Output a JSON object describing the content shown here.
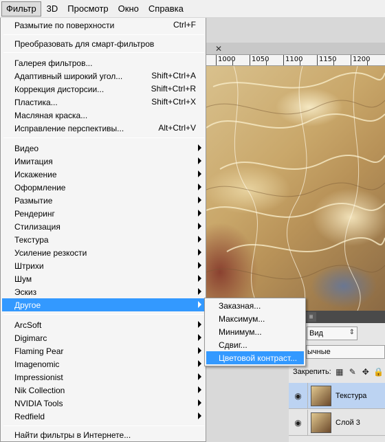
{
  "menubar": {
    "items": [
      "Фильтр",
      "3D",
      "Просмотр",
      "Окно",
      "Справка"
    ]
  },
  "ruler": {
    "labels": [
      "1000",
      "1050",
      "1100",
      "1150",
      "1200"
    ]
  },
  "filter_menu": {
    "group1": [
      {
        "label": "Размытие по поверхности",
        "shortcut": "Ctrl+F"
      }
    ],
    "group2": [
      {
        "label": "Преобразовать для смарт-фильтров"
      }
    ],
    "group3": [
      {
        "label": "Галерея фильтров..."
      },
      {
        "label": "Адаптивный широкий угол...",
        "shortcut": "Shift+Ctrl+A"
      },
      {
        "label": "Коррекция дисторсии...",
        "shortcut": "Shift+Ctrl+R"
      },
      {
        "label": "Пластика...",
        "shortcut": "Shift+Ctrl+X"
      },
      {
        "label": "Масляная краска..."
      },
      {
        "label": "Исправление перспективы...",
        "shortcut": "Alt+Ctrl+V"
      }
    ],
    "group4": [
      {
        "label": "Видео"
      },
      {
        "label": "Имитация"
      },
      {
        "label": "Искажение"
      },
      {
        "label": "Оформление"
      },
      {
        "label": "Размытие"
      },
      {
        "label": "Рендеринг"
      },
      {
        "label": "Стилизация"
      },
      {
        "label": "Текстура"
      },
      {
        "label": "Усиление резкости"
      },
      {
        "label": "Штрихи"
      },
      {
        "label": "Шум"
      },
      {
        "label": "Эскиз"
      },
      {
        "label": "Другое"
      }
    ],
    "group5": [
      {
        "label": "ArcSoft"
      },
      {
        "label": "Digimarc"
      },
      {
        "label": "Flaming Pear"
      },
      {
        "label": "Imagenomic"
      },
      {
        "label": "Impressionist"
      },
      {
        "label": "Nik Collection"
      },
      {
        "label": "NVIDIA Tools"
      },
      {
        "label": "Redfield"
      }
    ],
    "group6": [
      {
        "label": "Найти фильтры в Интернете..."
      }
    ]
  },
  "submenu": {
    "items": [
      "Заказная...",
      "Максимум...",
      "Минимум...",
      "Сдвиг...",
      "Цветовой контраст..."
    ]
  },
  "layers_panel": {
    "kind_label": "Вид",
    "blend_label": "ычные",
    "lock_label": "Закрепить:",
    "layers": [
      {
        "name": "Текстура"
      },
      {
        "name": "Слой 3"
      }
    ]
  },
  "colors": {
    "highlight": "#3399ff",
    "menu_bg": "#f5f5f5",
    "selected_layer": "#bcd3f2"
  }
}
